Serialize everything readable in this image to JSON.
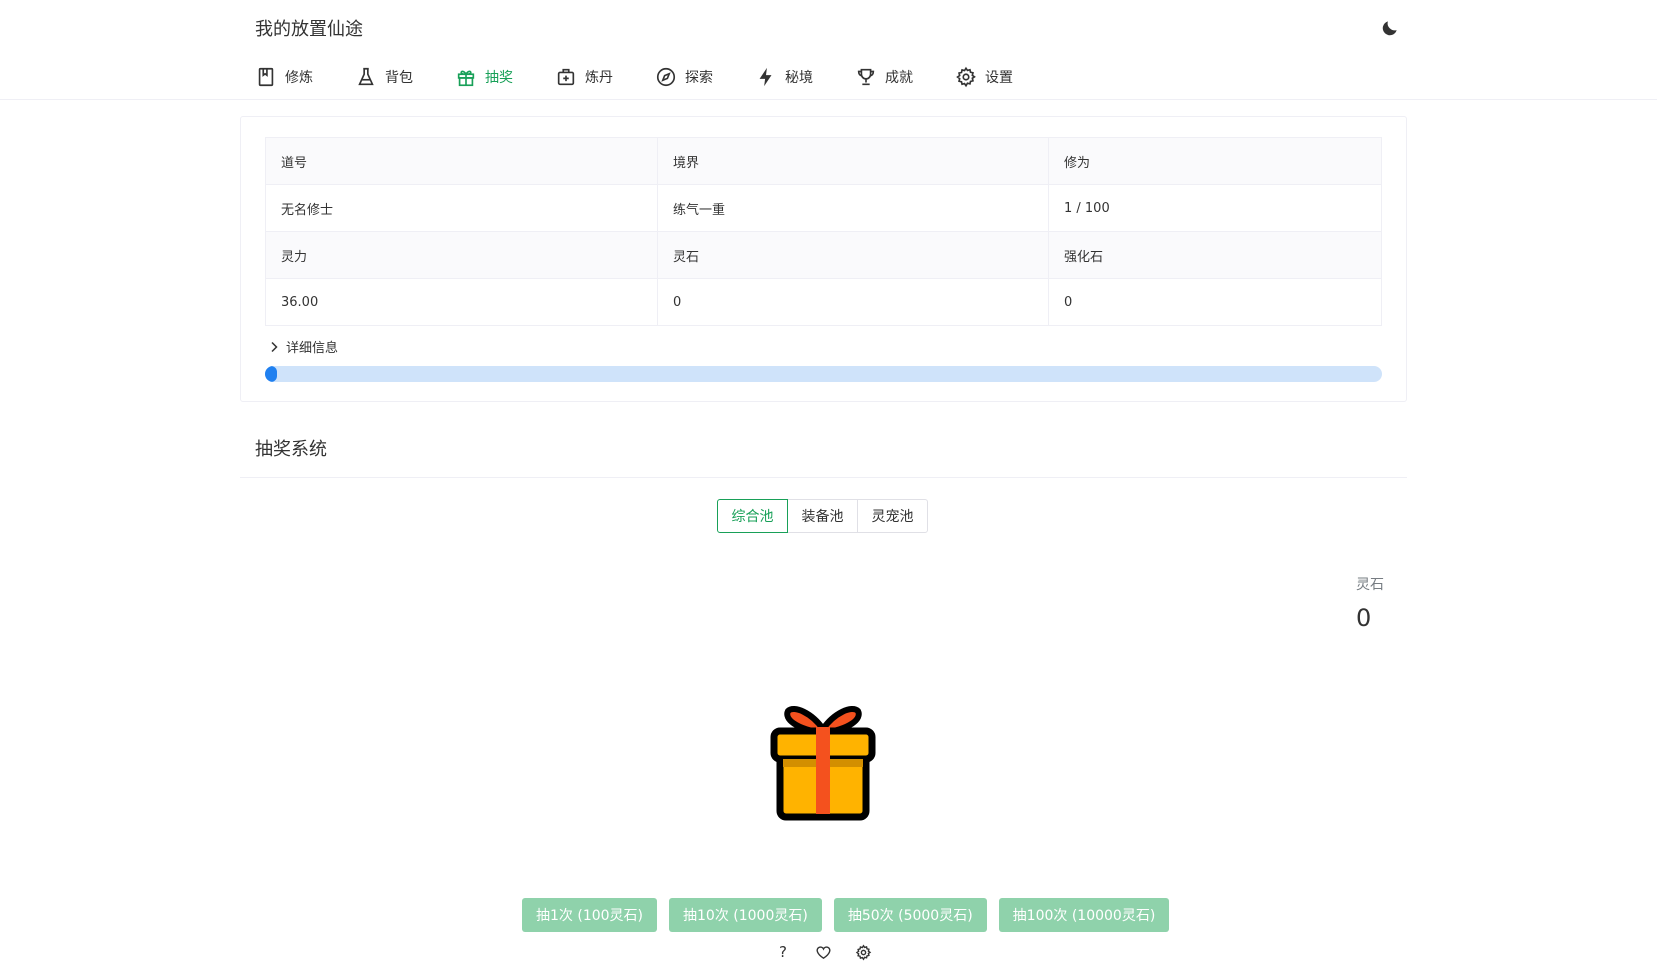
{
  "app": {
    "title": "我的放置仙途"
  },
  "header": {
    "theme_icon": "moon-icon"
  },
  "nav": [
    {
      "label": "修炼",
      "icon": "book-icon",
      "active": false
    },
    {
      "label": "背包",
      "icon": "flask-icon",
      "active": false
    },
    {
      "label": "抽奖",
      "icon": "gift-icon",
      "active": true
    },
    {
      "label": "炼丹",
      "icon": "medkit-icon",
      "active": false
    },
    {
      "label": "探索",
      "icon": "compass-icon",
      "active": false
    },
    {
      "label": "秘境",
      "icon": "flash-icon",
      "active": false
    },
    {
      "label": "成就",
      "icon": "trophy-icon",
      "active": false
    },
    {
      "label": "设置",
      "icon": "gear-icon",
      "active": false
    }
  ],
  "colors": {
    "accent": "#18a058",
    "progress": "#2080f0",
    "progress_track": "#cfe3fa",
    "button": "#8fd2ab"
  },
  "stats": {
    "rows": [
      [
        "道号",
        "境界",
        "修为"
      ],
      [
        "无名修士",
        "练气一重",
        "1 / 100"
      ],
      [
        "灵力",
        "灵石",
        "强化石"
      ],
      [
        "36.00",
        "0",
        "0"
      ]
    ],
    "details_label": "详细信息",
    "progress": {
      "percent": 1,
      "text": "1%"
    }
  },
  "gacha": {
    "title": "抽奖系统",
    "tabs": [
      {
        "label": "综合池",
        "active": true
      },
      {
        "label": "装备池",
        "active": false
      },
      {
        "label": "灵宠池",
        "active": false
      }
    ],
    "stone_label": "灵石",
    "stone_value": "0",
    "buttons": [
      "抽1次 (100灵石)",
      "抽10次 (1000灵石)",
      "抽50次 (5000灵石)",
      "抽100次 (10000灵石)"
    ],
    "help_symbol": "?"
  }
}
